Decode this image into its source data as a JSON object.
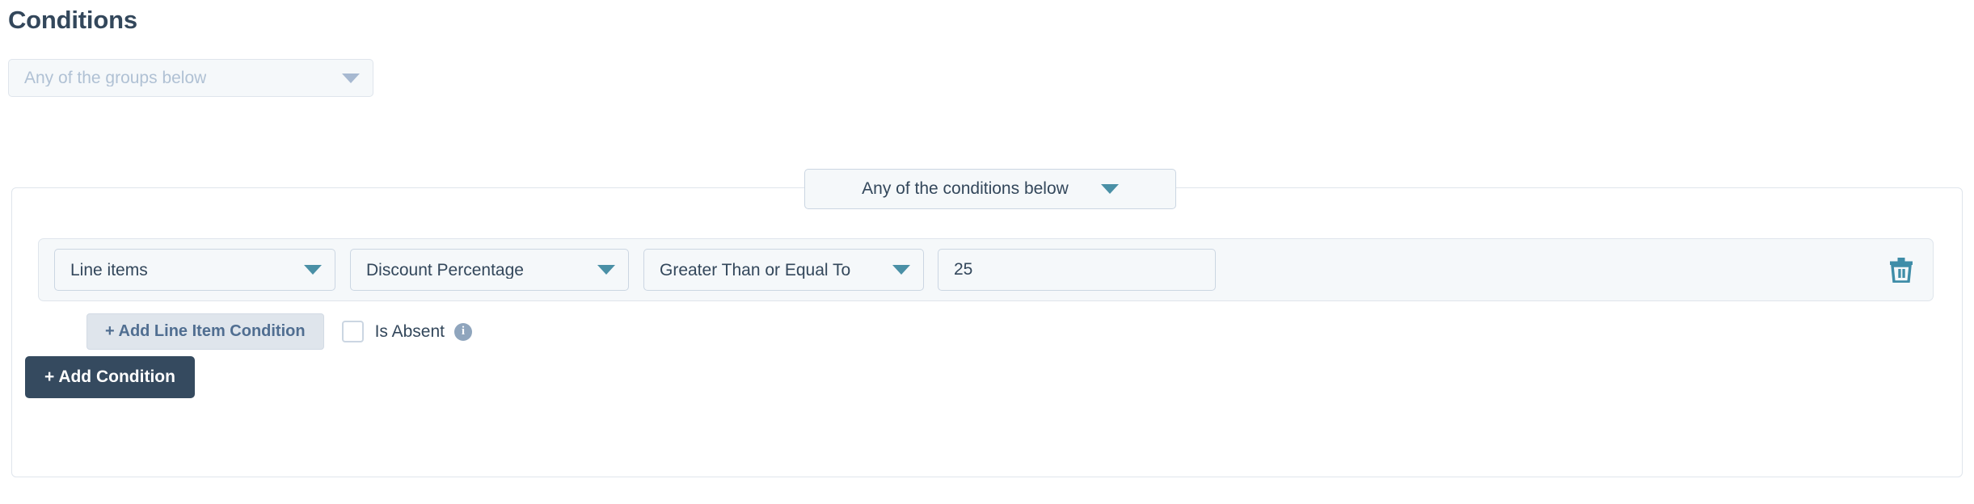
{
  "page": {
    "title": "Conditions"
  },
  "group_selector": {
    "value": "Any of the groups below",
    "caret_icon": "chevron-down-icon",
    "disabled": true
  },
  "join_selector": {
    "value": "Any of the conditions below",
    "caret_icon": "chevron-down-icon"
  },
  "condition_row": {
    "object": {
      "value": "Line items",
      "caret_icon": "chevron-down-icon"
    },
    "property": {
      "value": "Discount Percentage",
      "caret_icon": "chevron-down-icon"
    },
    "operator": {
      "value": "Greater Than or Equal To",
      "caret_icon": "chevron-down-icon"
    },
    "value_field": {
      "value": "25",
      "placeholder": ""
    },
    "delete": {
      "icon": "trash-icon"
    }
  },
  "sub_actions": {
    "add_line_item_label": "+ Add Line Item Condition",
    "is_absent_label": "Is Absent",
    "is_absent_checked": false,
    "info_icon": "info-icon",
    "info_glyph": "i"
  },
  "footer": {
    "add_condition_label": "+ Add Condition"
  },
  "colors": {
    "title": "#33475b",
    "accent_teal": "#4a90a6",
    "primary_button_bg": "#354a5f",
    "control_bg": "#f5f8fa",
    "control_border": "#cbd6e2",
    "muted_text": "#b0c1d4",
    "secondary_button_bg": "#dfe5ec",
    "secondary_button_text": "#506e91",
    "info_icon_bg": "#8fa5bd"
  }
}
